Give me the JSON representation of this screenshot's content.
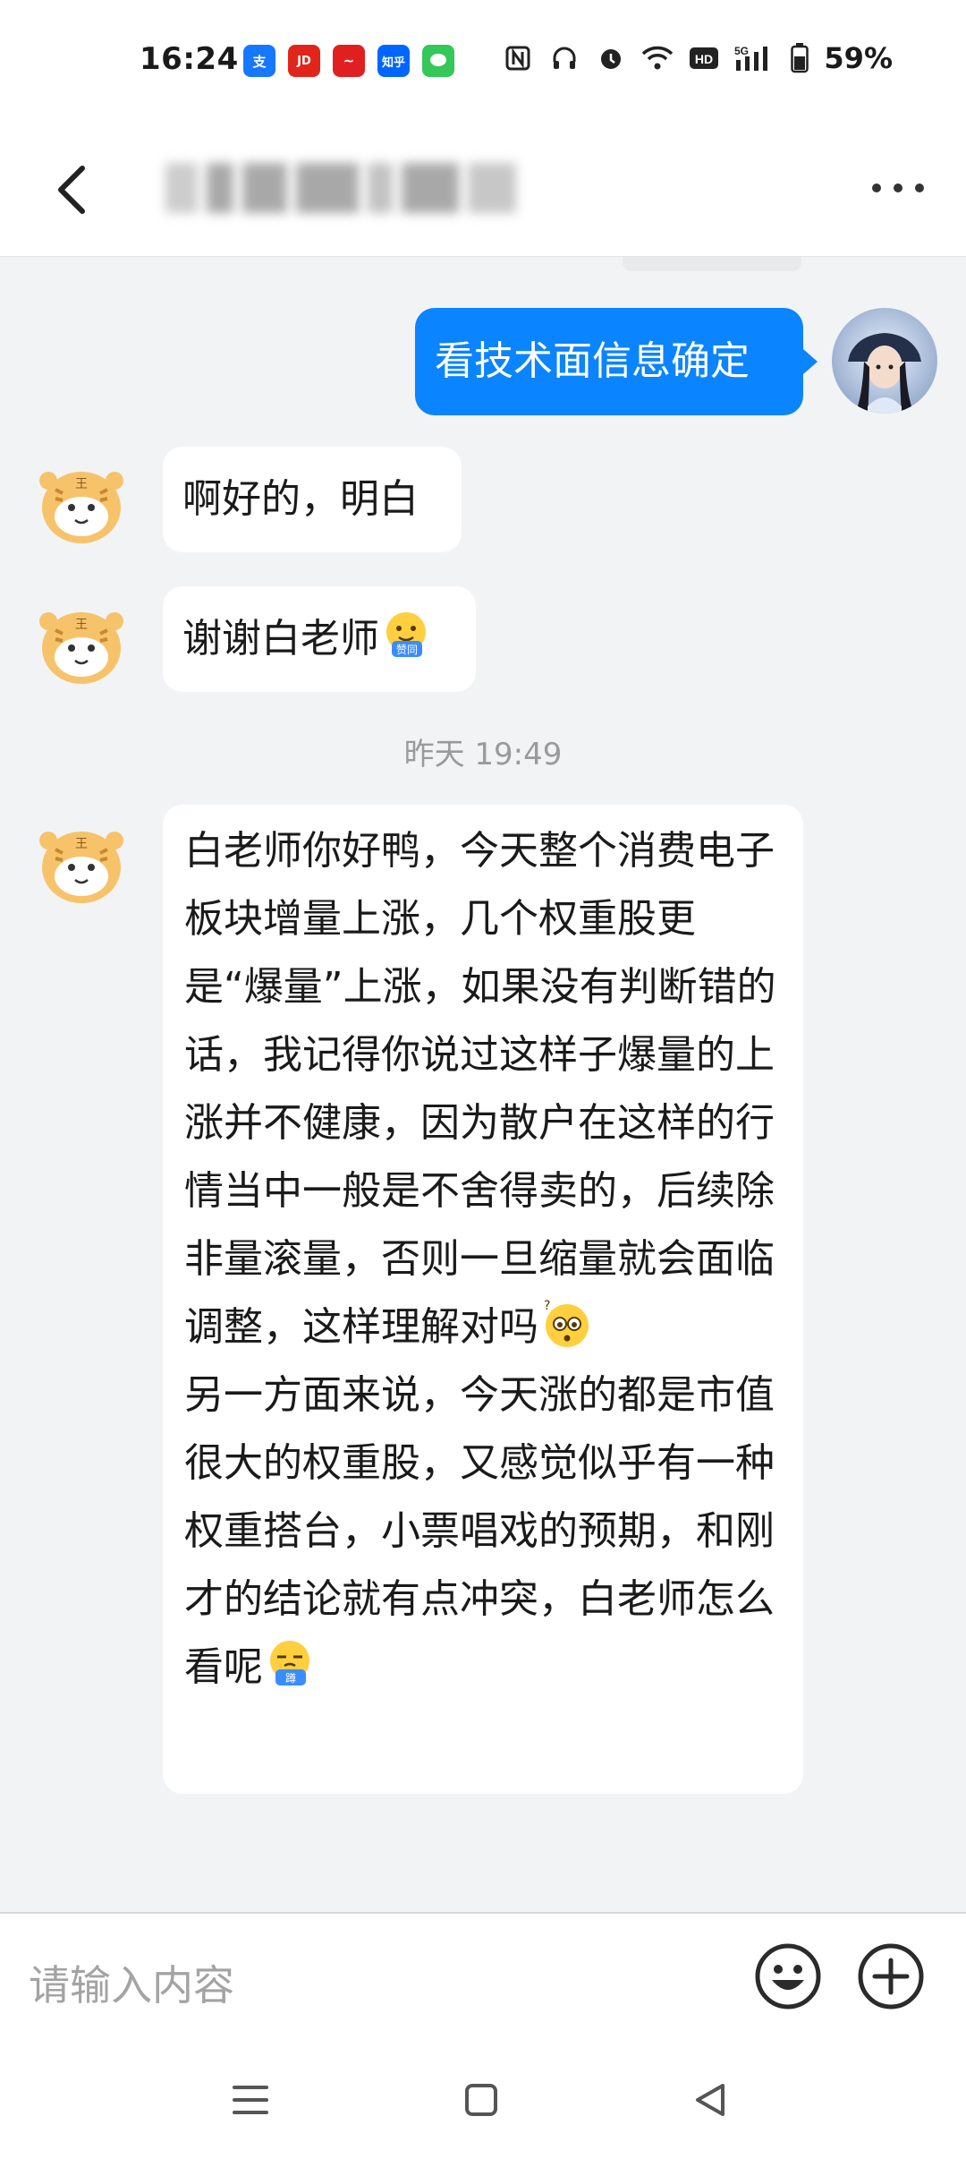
{
  "status_bar": {
    "time": "16:24",
    "battery": "59%",
    "app_icons": [
      {
        "name": "alipay-icon",
        "label": "支",
        "color": "#1677ff"
      },
      {
        "name": "jd-icon",
        "label": "JD",
        "color": "#e1251b"
      },
      {
        "name": "stock-app-icon",
        "label": "~",
        "color": "#e02020"
      },
      {
        "name": "zhihu-icon",
        "label": "知乎",
        "color": "#0066ff"
      },
      {
        "name": "message-app-icon",
        "label": "",
        "color": "#34c759"
      }
    ]
  },
  "header": {
    "back_icon": "chevron-left-icon",
    "more_icon": "more-dots-icon"
  },
  "messages": [
    {
      "from": "self",
      "text": "看技术面信息确定"
    },
    {
      "from": "other",
      "text": "啊好的，明白"
    },
    {
      "from": "other",
      "text": "谢谢白老师",
      "emoji": "thumbs-up-emoji",
      "emoji_label": "赞同"
    },
    {
      "type": "timestamp",
      "text": "昨天 19:49"
    },
    {
      "from": "other",
      "text_part1": "白老师你好鸭，今天整个消费电子板块增量上涨，几个权重股更是“爆量”上涨，如果没有判断错的话，我记得你说过这样子爆量的上涨并不健康，因为散户在这样的行情当中一般是不舍得卖的，后续除非量滚量，否则一旦缩量就会面临调整，这样理解对吗",
      "text_part2": "另一方面来说，今天涨的都是市值很大的权重股，又感觉似乎有一种权重搭台，小票唱戏的预期，和刚才的结论就有点冲突，白老师怎么看呢",
      "emoji1": "question-face-emoji",
      "emoji2": "squat-emoji",
      "emoji2_label": "蹲"
    }
  ],
  "input": {
    "placeholder": "请输入内容"
  },
  "colors": {
    "self_bubble": "#0b84ff",
    "other_bubble": "#ffffff",
    "background": "#f2f3f5"
  }
}
